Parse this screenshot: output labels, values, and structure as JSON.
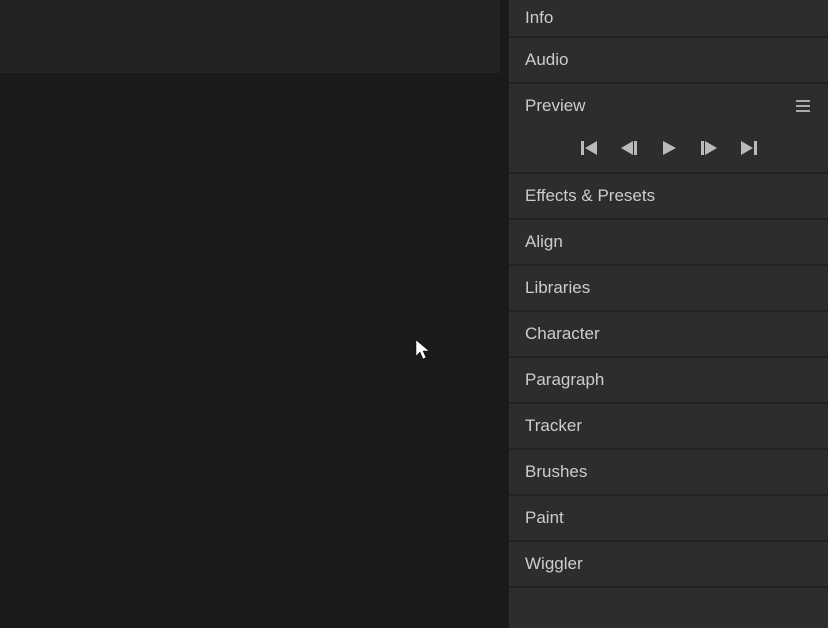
{
  "panels": {
    "info": "Info",
    "audio": "Audio",
    "preview": "Preview",
    "effects_presets": "Effects & Presets",
    "align": "Align",
    "libraries": "Libraries",
    "character": "Character",
    "paragraph": "Paragraph",
    "tracker": "Tracker",
    "brushes": "Brushes",
    "paint": "Paint",
    "wiggler": "Wiggler"
  }
}
